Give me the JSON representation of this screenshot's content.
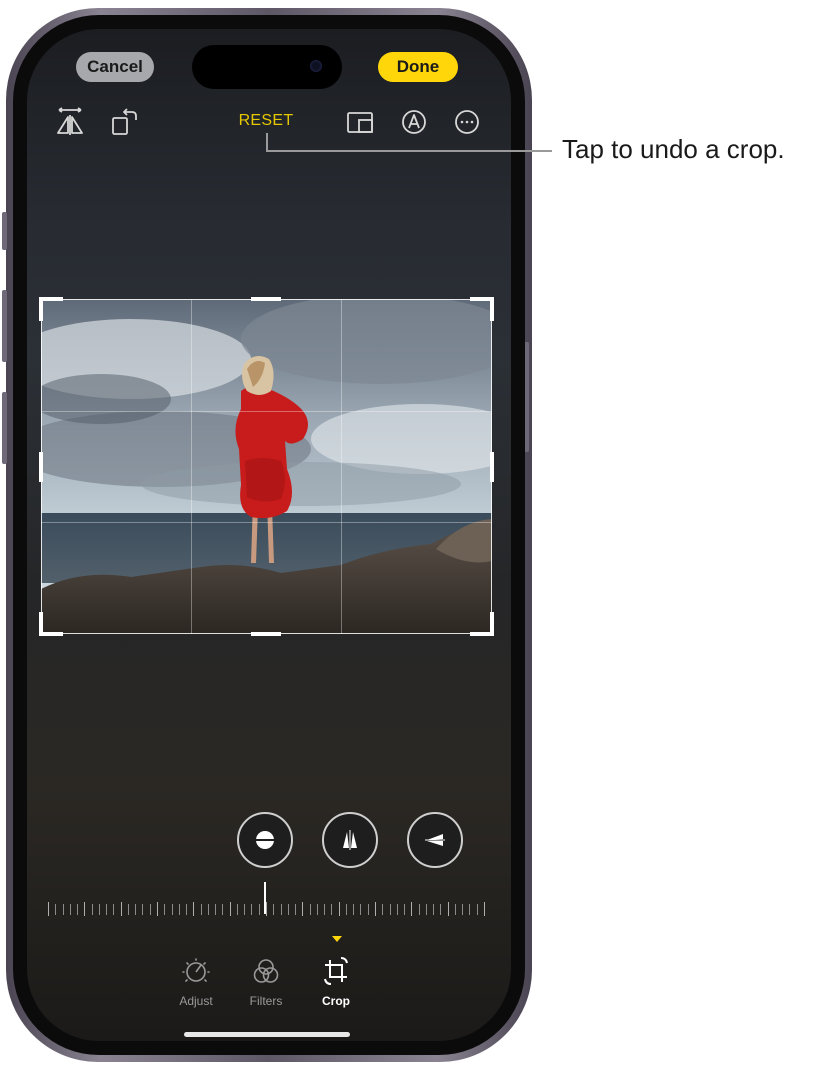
{
  "header": {
    "cancel_label": "Cancel",
    "done_label": "Done",
    "reset_label": "RESET"
  },
  "toolbar_icons": [
    "flip-horizontal-icon",
    "rotate-icon",
    "aspect-ratio-icon",
    "markup-icon",
    "more-icon"
  ],
  "callout": {
    "text": "Tap to undo a crop."
  },
  "straighten_controls": [
    "straighten-icon",
    "vertical-perspective-icon",
    "horizontal-perspective-icon"
  ],
  "tabs": [
    {
      "label": "Adjust",
      "icon": "adjust-dial-icon",
      "active": false
    },
    {
      "label": "Filters",
      "icon": "filters-icon",
      "active": false
    },
    {
      "label": "Crop",
      "icon": "crop-icon",
      "active": true
    }
  ],
  "colors": {
    "accent_yellow": "#ffd60a",
    "reset_yellow": "#e6c800",
    "dress_red": "#c81c1c"
  }
}
